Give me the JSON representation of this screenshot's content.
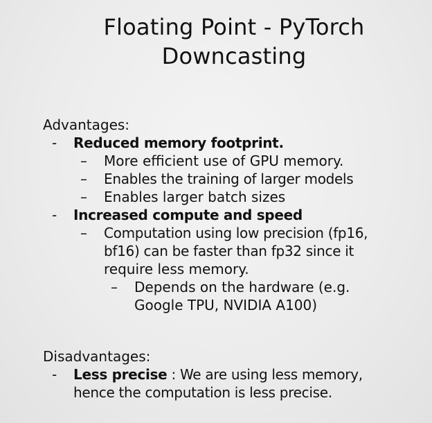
{
  "title": {
    "line1": "Floating Point - PyTorch",
    "line2": "Downcasting"
  },
  "advantages": {
    "heading": "Advantages:",
    "point1": {
      "label": "Reduced memory footprint.",
      "subpoints": [
        "More efficient use of GPU memory.",
        "Enables the training of larger models",
        "Enables larger batch sizes"
      ]
    },
    "point2": {
      "label": "Increased compute and speed",
      "sub1": {
        "line1": "Computation using low precision (fp16,",
        "line2": "bf16) can be faster than fp32 since it",
        "line3": "require less memory."
      },
      "sub1_detail": {
        "line1": "Depends on the hardware (e.g.",
        "line2": "Google TPU, NVIDIA A100)"
      }
    }
  },
  "disadvantages": {
    "heading": "Disadvantages:",
    "point1": {
      "bold": "Less precise",
      "rest_line1": " : We are using less memory,",
      "line2": "hence the computation is less precise."
    }
  },
  "bullet_char": "-",
  "sub_bullet_char": "–"
}
